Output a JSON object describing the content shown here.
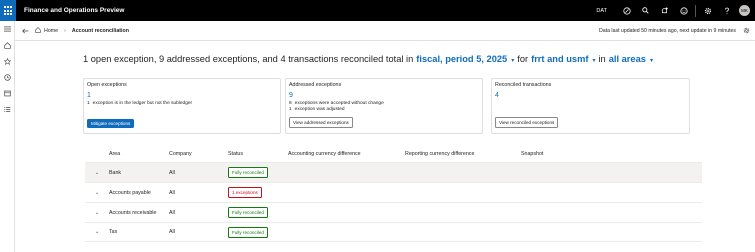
{
  "app": {
    "title": "Finance and Operations Preview",
    "company_code": "DAT",
    "user_initials": "MK",
    "icons": [
      "waffle-icon",
      "copilot-icon",
      "search-icon",
      "notification-icon",
      "smiley-icon",
      "settings-icon",
      "help-icon"
    ]
  },
  "nav": {
    "items": [
      "menu-icon",
      "home-icon",
      "star-icon",
      "recent-icon",
      "workspace-icon",
      "list-icon"
    ]
  },
  "subheader": {
    "home_label": "Home",
    "current_page": "Account reconciliation",
    "status_text": "Data last updated 50 minutes ago, next update in 9 minutes"
  },
  "headline": {
    "prefix": "1 open exception, 9 addressed exceptions, and 4 transactions reconciled total in",
    "period": "fiscal, period 5, 2025",
    "for_word": "for",
    "companies": "frrt and usmf",
    "in_word": "in",
    "areas": "all areas"
  },
  "cards": {
    "open": {
      "title": "Open exceptions",
      "count": "1",
      "line1_count": "1",
      "line1_text": "exception is in the ledger but not the subledger",
      "button": "Mitigate exceptions"
    },
    "addressed": {
      "title": "Addressed exceptions",
      "count": "9",
      "line1_count": "8",
      "line1_text": "exceptions were accepted without change",
      "line2_count": "1",
      "line2_text": "exception was adjusted",
      "button": "View addressed exceptions"
    },
    "reconciled": {
      "title": "Reconciled transactions",
      "count": "4",
      "button": "View reconciled exceptions"
    }
  },
  "table": {
    "headers": {
      "area": "Area",
      "company": "Company",
      "status": "Status",
      "accounting": "Accounting currency difference",
      "reporting": "Reporting currency difference",
      "snapshot": "Snapshot"
    },
    "rows": [
      {
        "area": "Bank",
        "company": "All",
        "status": "Fully reconciled",
        "status_type": "ok"
      },
      {
        "area": "Accounts payable",
        "company": "All",
        "status": "1 exceptions",
        "status_type": "err"
      },
      {
        "area": "Accounts receivable",
        "company": "All",
        "status": "Fully reconciled",
        "status_type": "ok"
      },
      {
        "area": "Tax",
        "company": "All",
        "status": "Fully reconciled",
        "status_type": "ok"
      }
    ]
  },
  "colors": {
    "brand": "#0f6cbd",
    "success": "#107c10",
    "danger": "#c50f1f"
  }
}
